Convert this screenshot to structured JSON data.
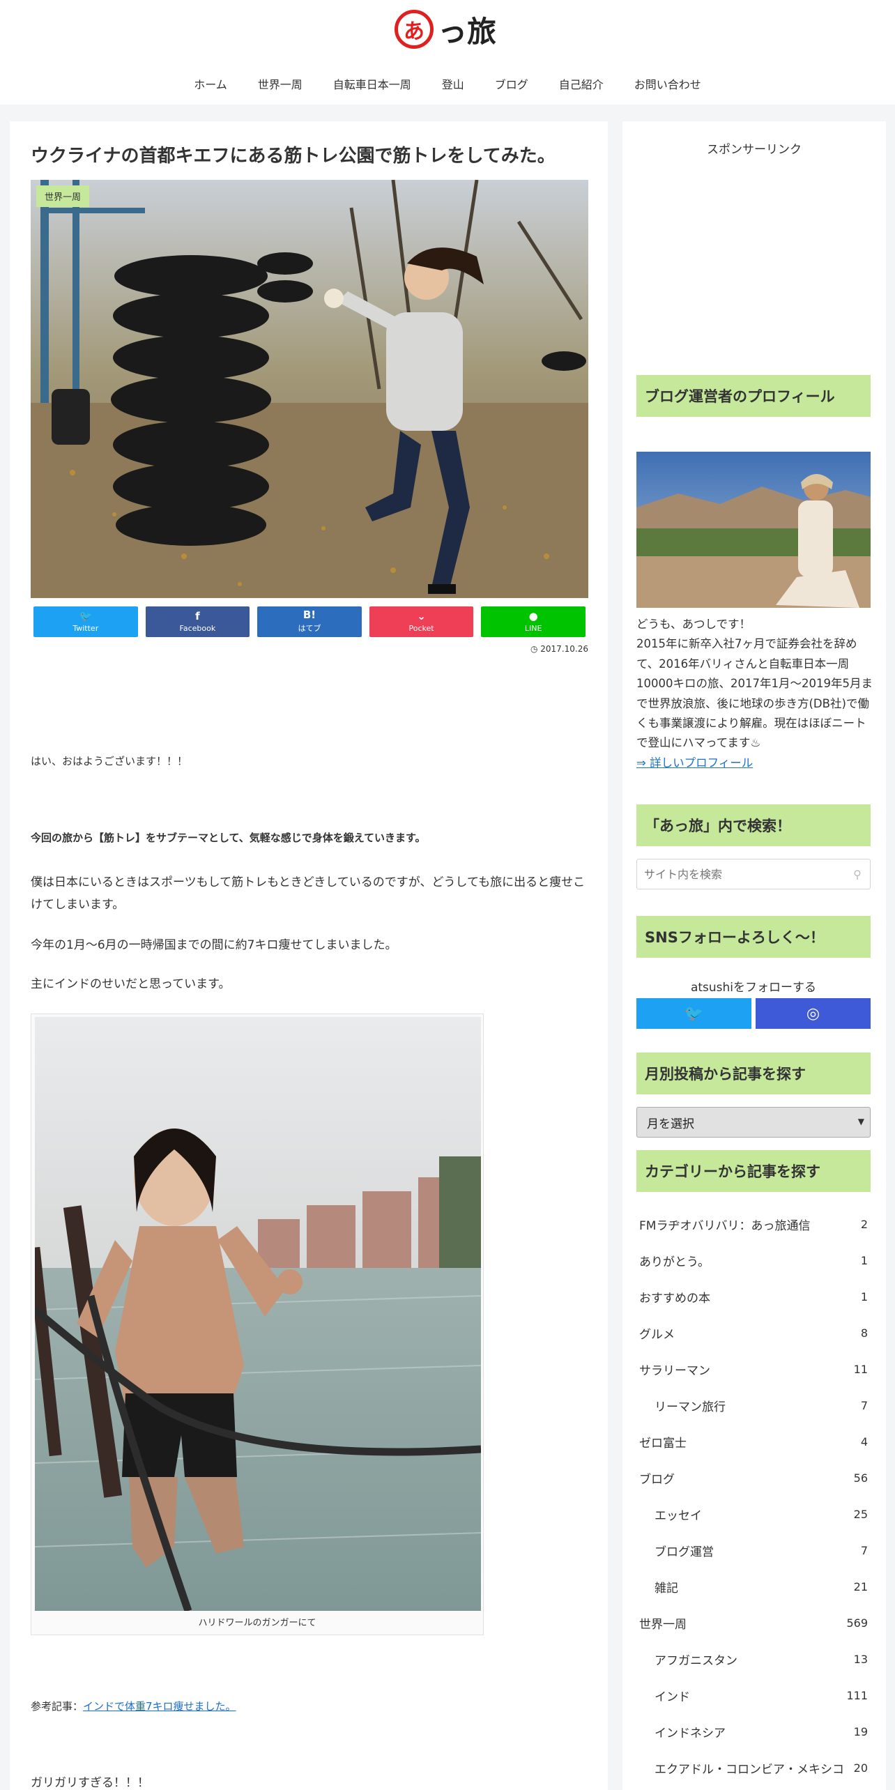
{
  "header": {
    "logo_mark": "あ",
    "logo_text": "っ旅",
    "nav": [
      "ホーム",
      "世界一周",
      "自転車日本一周",
      "登山",
      "ブログ",
      "自己紹介",
      "お問い合わせ"
    ]
  },
  "article": {
    "title": "ウクライナの首都キエフにある筋トレ公園で筋トレをしてみた。",
    "category": "世界一周",
    "share": [
      {
        "label": "Twitter",
        "icon": "twitter-icon",
        "glyph": "🐦",
        "color": "#1da1f2"
      },
      {
        "label": "Facebook",
        "icon": "facebook-icon",
        "glyph": "f",
        "color": "#3b5998"
      },
      {
        "label": "はてブ",
        "icon": "hatena-icon",
        "glyph": "B!",
        "color": "#2c6ebd"
      },
      {
        "label": "Pocket",
        "icon": "pocket-icon",
        "glyph": "⌄",
        "color": "#ef3f56"
      },
      {
        "label": "LINE",
        "icon": "line-icon",
        "glyph": "●",
        "color": "#00c300"
      }
    ],
    "date": "2017.10.26",
    "date_icon": "clock-icon",
    "paragraphs": [
      "はい、おはようございます！！！",
      "今回の旅から【筋トレ】をサブテーマとして、気軽な感じで身体を鍛えていきます。",
      "僕は日本にいるときはスポーツもして筋トレもときどきしているのですが、どうしても旅に出ると痩せこけてしまいます。",
      "今年の1月～6月の一時帰国までの間に約7キロ痩せてしまいました。",
      "主にインドのせいだと思っています。"
    ],
    "figure_caption": "ハリドワールのガンガーにて",
    "ref_prefix": "参考記事：",
    "ref_link": "インドで体重7キロ痩せました。",
    "last_line": "ガリガリすぎる！！！"
  },
  "sidebar": {
    "sponsor": "スポンサーリンク",
    "profile_title": "ブログ運営者のプロフィール",
    "profile_greeting": "どうも、あつしです！",
    "profile_body": "2015年に新卒入社7ヶ月で証券会社を辞めて、2016年バリィさんと自転車日本一周10000キロの旅、2017年1月～2019年5月まで世界放浪旅、後に地球の歩き方(DB社)で働くも事業譲渡により解雇。現在はほぼニートで登山にハマってます♨",
    "profile_link": "⇒ 詳しいプロフィール",
    "search_title": "「あっ旅」内で検索！",
    "search_placeholder": "サイト内を検索",
    "sns_title": "SNSフォローよろしく～！",
    "follow_text": "atsushiをフォローする",
    "sns_colors": {
      "twitter": "#1da1f2",
      "instagram": "#3f5ad9"
    },
    "archive_title": "月別投稿から記事を探す",
    "archive_select": "月を選択",
    "category_title": "カテゴリーから記事を探す",
    "categories": [
      {
        "name": "FMラヂオバリバリ：あっ旅通信",
        "count": "2",
        "child": false
      },
      {
        "name": "ありがとう。",
        "count": "1",
        "child": false
      },
      {
        "name": "おすすめの本",
        "count": "1",
        "child": false
      },
      {
        "name": "グルメ",
        "count": "8",
        "child": false
      },
      {
        "name": "サラリーマン",
        "count": "11",
        "child": false
      },
      {
        "name": "リーマン旅行",
        "count": "7",
        "child": true
      },
      {
        "name": "ゼロ富士",
        "count": "4",
        "child": false
      },
      {
        "name": "ブログ",
        "count": "56",
        "child": false
      },
      {
        "name": "エッセイ",
        "count": "25",
        "child": true
      },
      {
        "name": "ブログ運営",
        "count": "7",
        "child": true
      },
      {
        "name": "雑記",
        "count": "21",
        "child": true
      },
      {
        "name": "世界一周",
        "count": "569",
        "child": false
      },
      {
        "name": "アフガニスタン",
        "count": "13",
        "child": true
      },
      {
        "name": "インド",
        "count": "111",
        "child": true
      },
      {
        "name": "インドネシア",
        "count": "19",
        "child": true
      },
      {
        "name": "エクアドル・コロンビア・メキシコ",
        "count": "20",
        "child": true
      }
    ]
  }
}
